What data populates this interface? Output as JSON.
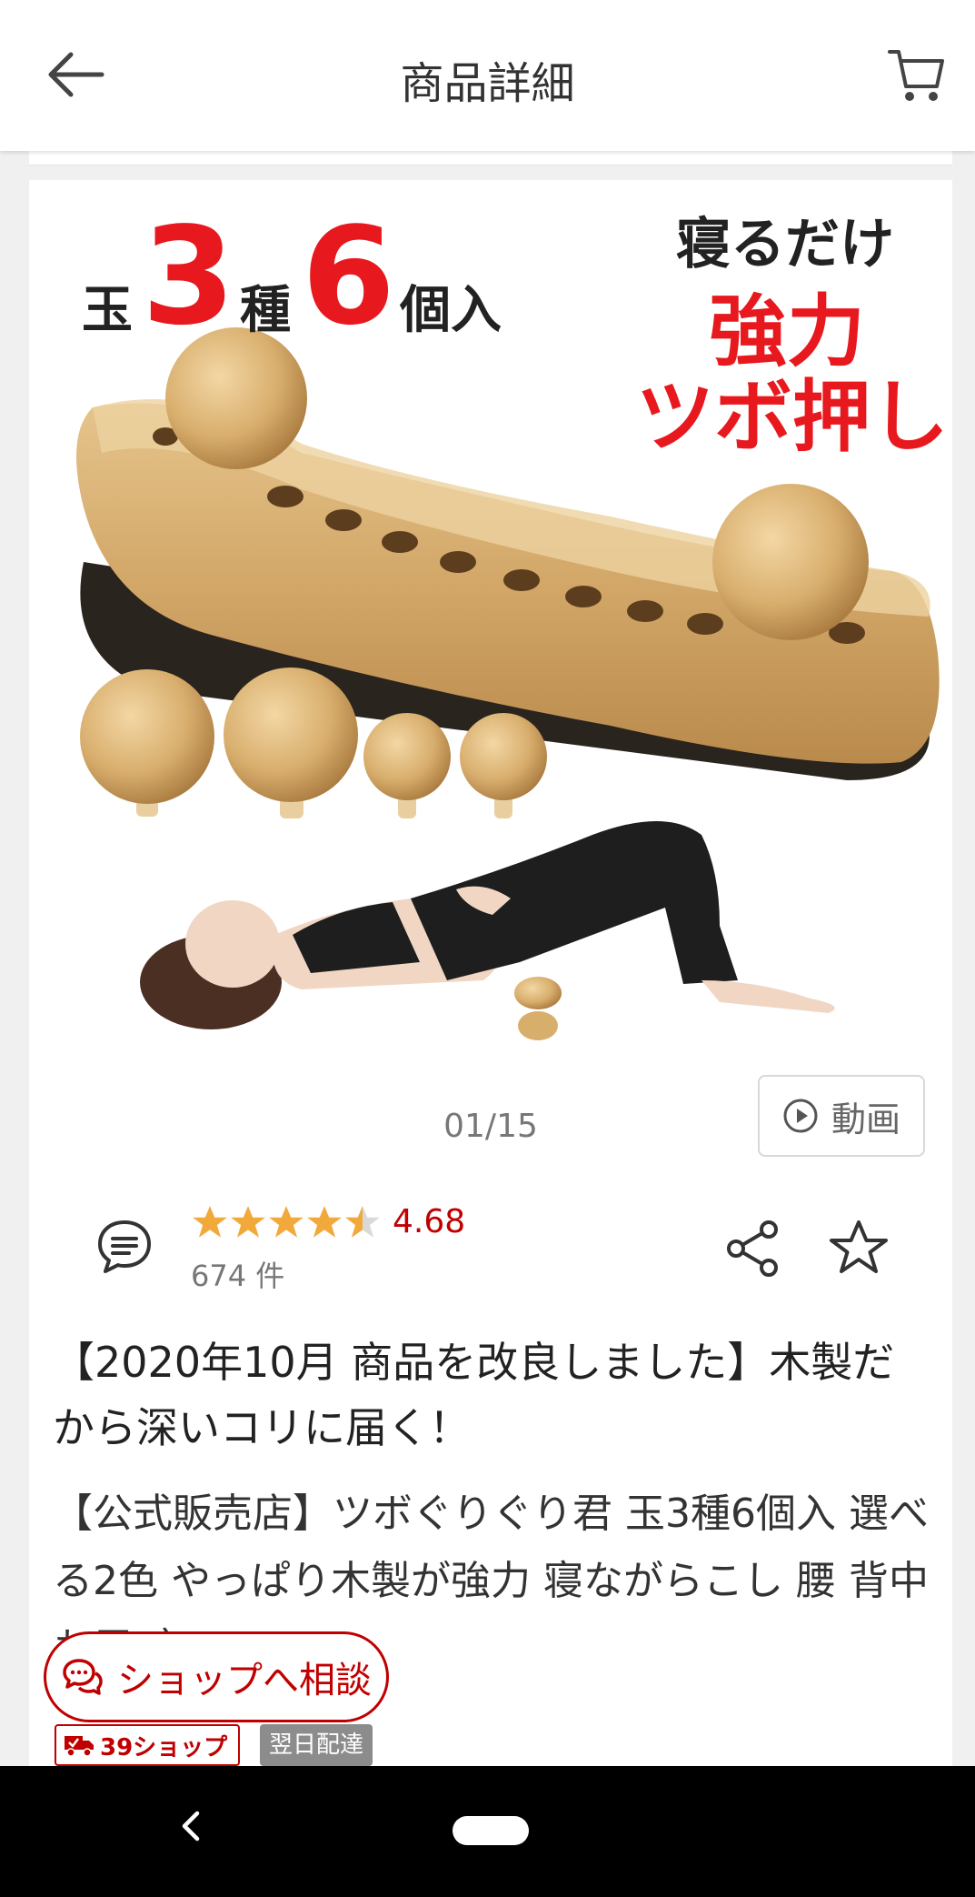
{
  "header": {
    "title": "商品詳細",
    "back_icon": "arrow-left-icon",
    "cart_icon": "cart-icon"
  },
  "hero": {
    "text_tama": "玉",
    "text_3": "3",
    "text_shu": "種",
    "text_6": "6",
    "text_kosu": "個入",
    "text_neru": "寝るだけ",
    "text_kyoryoku": "強力",
    "text_tsubo": "ツボ押し"
  },
  "gallery": {
    "pager": "01/15",
    "video_label": "動画"
  },
  "rating": {
    "stars": 4.68,
    "score_text": "4.68",
    "count_text": "674 件",
    "star_color": "#f2a93b",
    "score_color": "#c00000"
  },
  "product": {
    "title": "【2020年10月 商品を改良しました】木製だから深いコリに届く！",
    "subtitle": "【公式販売店】ツボぐりぐり君 玉3種6個入 選べる2色 やっぱり木製が強力 寝ながらこし 腰 背中 お尻 肩"
  },
  "badges": {
    "shop": "39ショップ",
    "next_day": "翌日配達"
  },
  "consult": {
    "label": "ショップへ相談",
    "accent": "#c00000"
  }
}
